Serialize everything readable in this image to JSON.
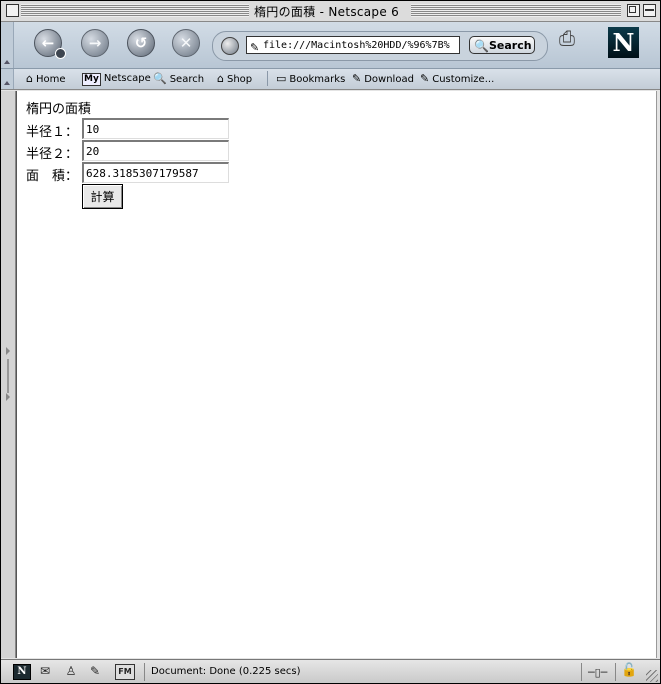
{
  "window": {
    "title": "楕円の面積 - Netscape 6"
  },
  "nav": {
    "back_icon": "back-arrow-icon",
    "forward_icon": "forward-arrow-icon",
    "reload_icon": "reload-icon",
    "stop_icon": "stop-icon",
    "url": "file:///Macintosh%20HDD/%96%7B%",
    "search_label": "Search"
  },
  "personal_toolbar": {
    "items": [
      {
        "label": "Home",
        "icon": "home-icon"
      },
      {
        "label": "Netscape",
        "icon": "my-netscape-icon"
      },
      {
        "label": "Search",
        "icon": "search-icon"
      },
      {
        "label": "Shop",
        "icon": "shop-icon"
      },
      {
        "label": "Bookmarks",
        "icon": "bookmarks-folder-icon"
      },
      {
        "label": "Download",
        "icon": "bookmark-icon"
      },
      {
        "label": "Customize...",
        "icon": "bookmark-icon"
      }
    ],
    "my_badge": "My"
  },
  "page": {
    "heading": "楕円の面積",
    "radius1_label": "半径１：",
    "radius1_value": "10",
    "radius2_label": "半径２：",
    "radius2_value": "20",
    "area_label": "面　積：",
    "area_value": "628.3185307179587",
    "calc_label": "計算"
  },
  "status": {
    "text": "Document: Done (0.225 secs)",
    "netscape_badge": "N",
    "fm_badge": "FM"
  }
}
